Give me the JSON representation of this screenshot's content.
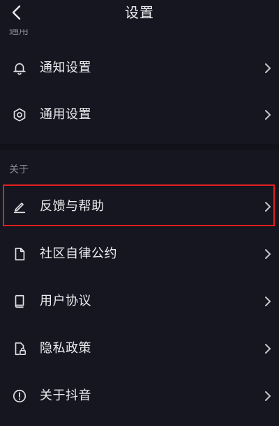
{
  "header": {
    "title": "设置",
    "back_icon": "chevron-left-icon"
  },
  "sections": {
    "general_label_clipped": "通用",
    "about_label": "关于"
  },
  "general_items": [
    {
      "label": "通知设置",
      "icon": "bell-icon"
    },
    {
      "label": "通用设置",
      "icon": "gear-icon"
    }
  ],
  "about_items": [
    {
      "label": "反馈与帮助",
      "icon": "pencil-icon",
      "highlighted": true
    },
    {
      "label": "社区自律公约",
      "icon": "document-icon"
    },
    {
      "label": "用户协议",
      "icon": "book-icon"
    },
    {
      "label": "隐私政策",
      "icon": "privacy-lock-icon"
    },
    {
      "label": "关于抖音",
      "icon": "info-circle-icon"
    }
  ],
  "colors": {
    "background": "#15161f",
    "text": "#ececf0",
    "muted_text": "#8a8b95",
    "highlight_border": "#e02121"
  }
}
